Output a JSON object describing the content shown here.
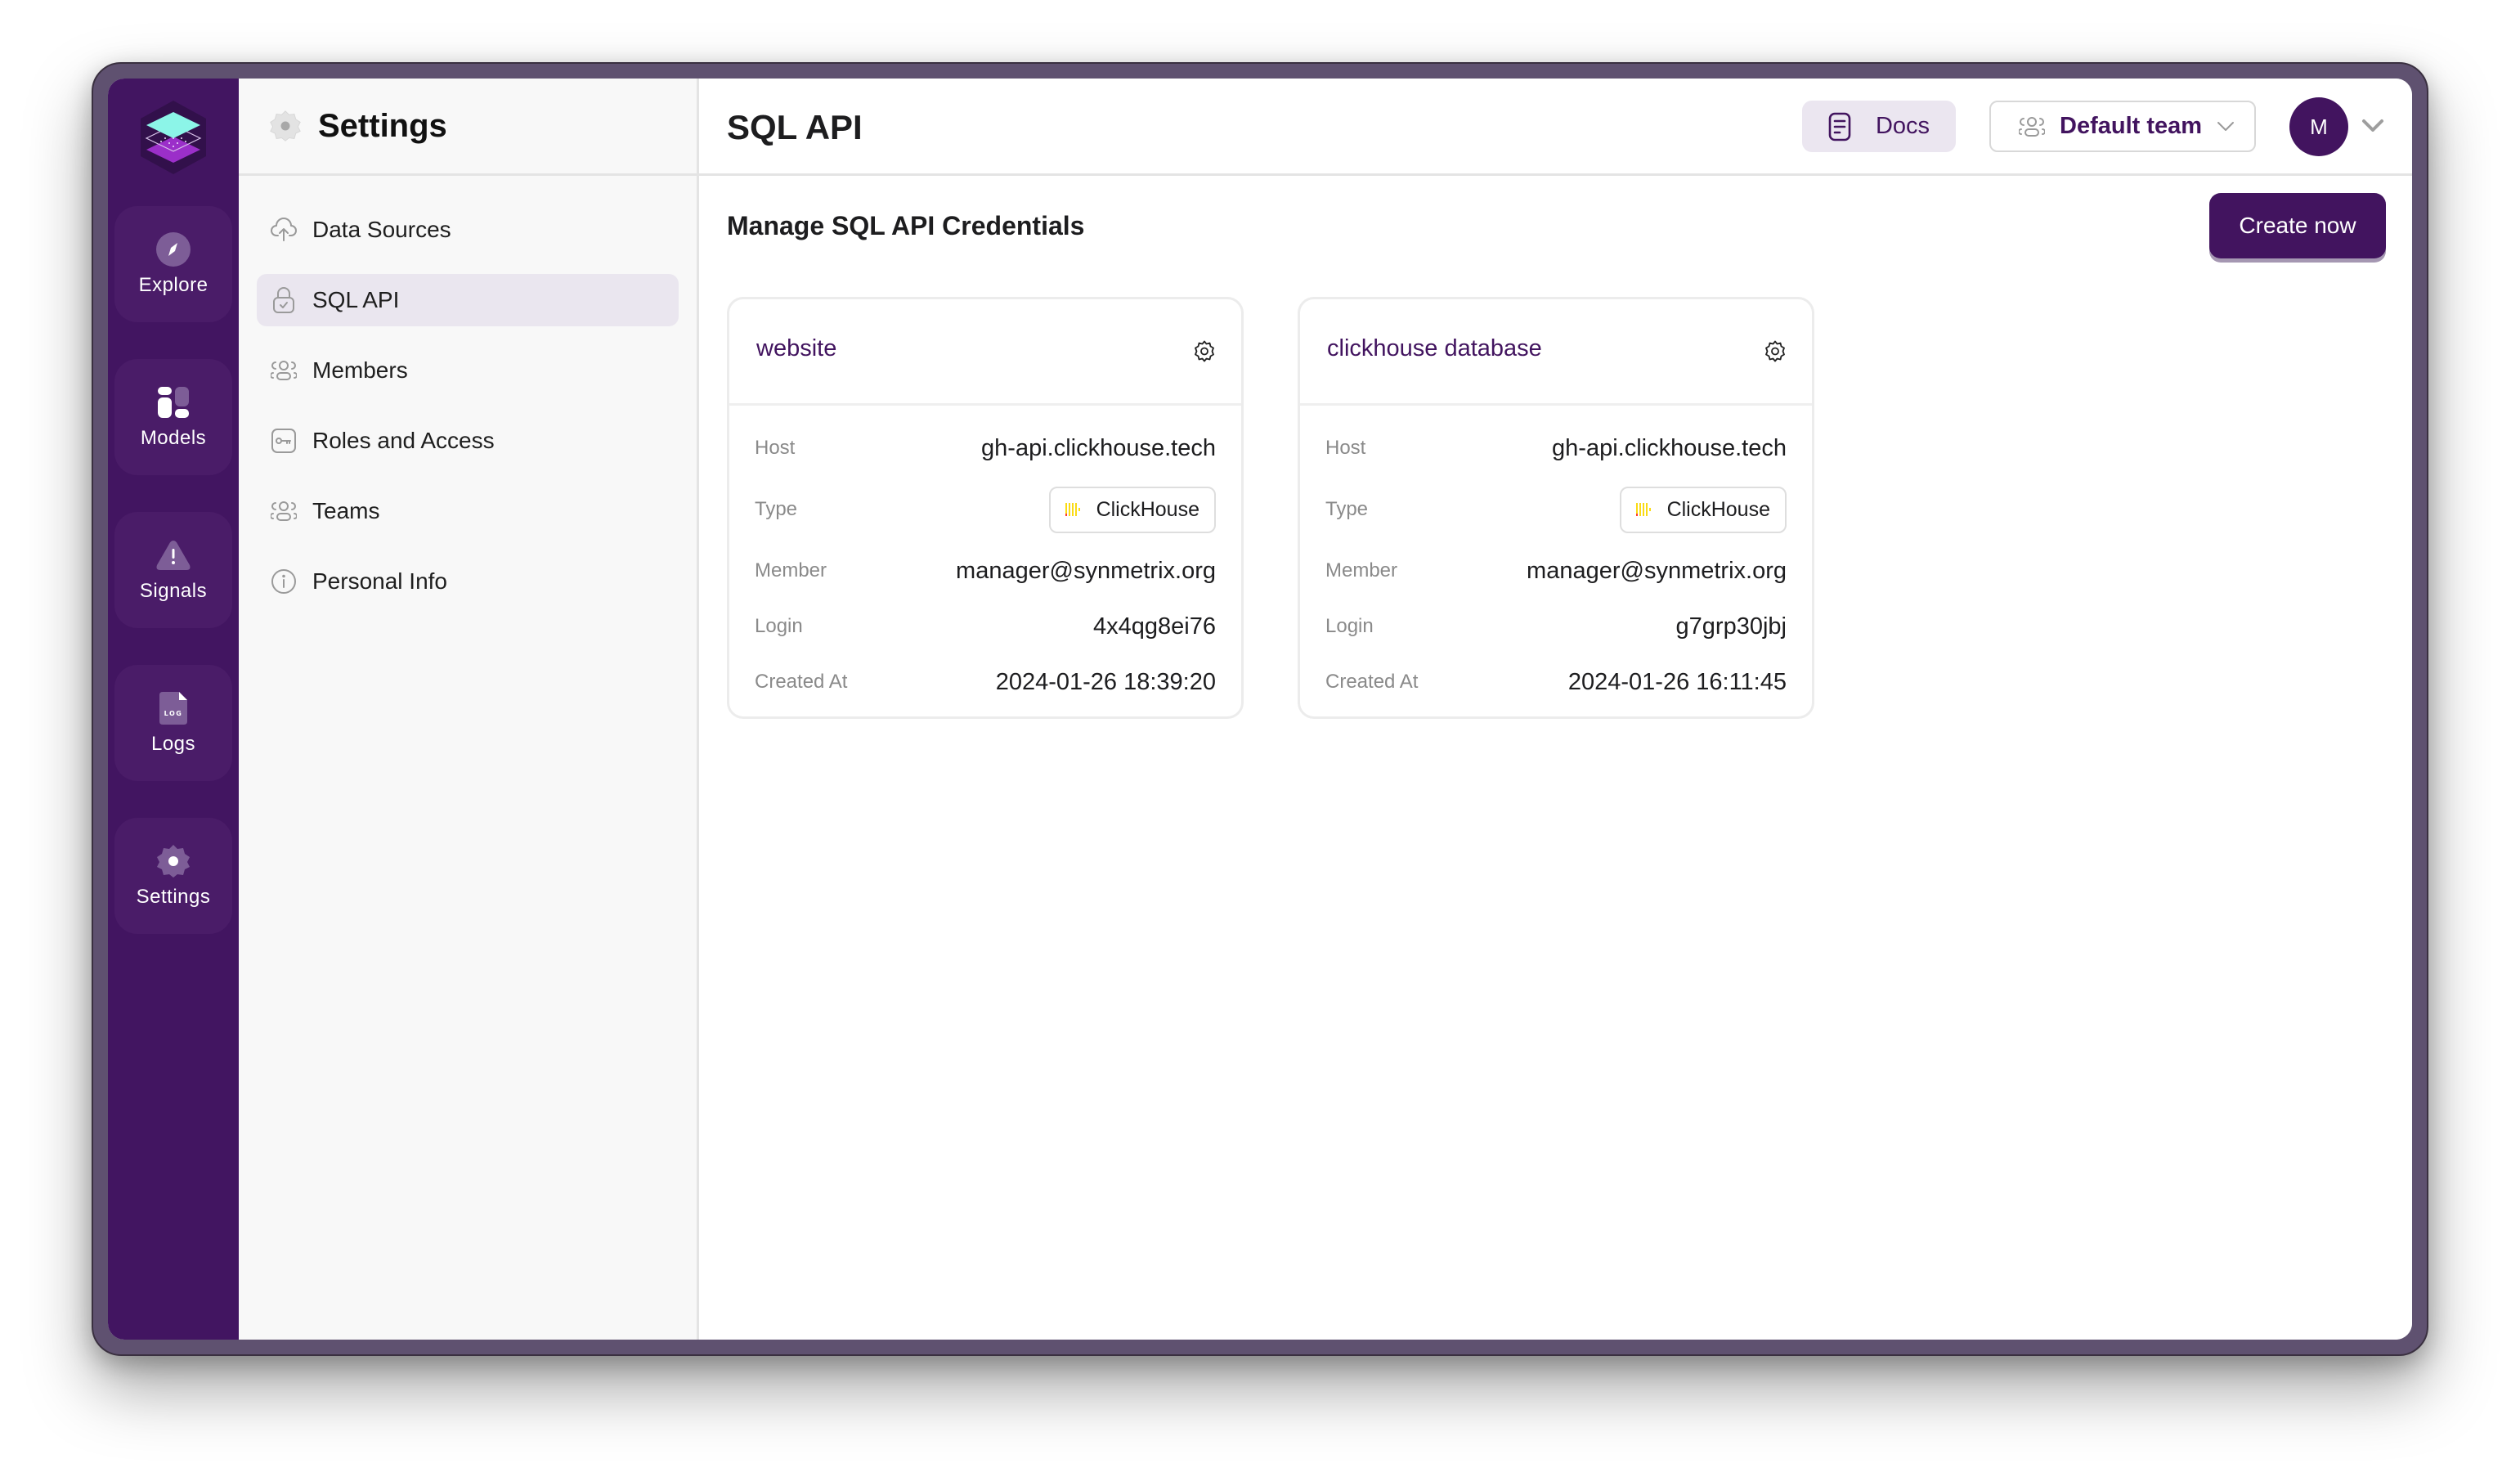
{
  "rail": {
    "items": [
      {
        "label": "Explore",
        "icon": "compass-icon"
      },
      {
        "label": "Models",
        "icon": "models-icon"
      },
      {
        "label": "Signals",
        "icon": "warning-icon"
      },
      {
        "label": "Logs",
        "icon": "log-file-icon"
      },
      {
        "label": "Settings",
        "icon": "gear-icon"
      }
    ]
  },
  "settings_panel": {
    "title": "Settings",
    "items": [
      {
        "label": "Data Sources",
        "icon": "cloud-upload-icon",
        "active": false
      },
      {
        "label": "SQL API",
        "icon": "lock-icon",
        "active": true
      },
      {
        "label": "Members",
        "icon": "users-icon",
        "active": false
      },
      {
        "label": "Roles and Access",
        "icon": "key-icon",
        "active": false
      },
      {
        "label": "Teams",
        "icon": "users-icon",
        "active": false
      },
      {
        "label": "Personal Info",
        "icon": "info-icon",
        "active": false
      }
    ]
  },
  "header": {
    "title": "SQL API",
    "docs_label": "Docs",
    "team_select_value": "Default team",
    "avatar_initial": "M"
  },
  "content": {
    "section_title": "Manage SQL API Credentials",
    "create_label": "Create now",
    "field_labels": {
      "host": "Host",
      "type": "Type",
      "member": "Member",
      "login": "Login",
      "created_at": "Created At"
    },
    "credentials": [
      {
        "name": "website",
        "host": "gh-api.clickhouse.tech",
        "type": "ClickHouse",
        "member": "manager@synmetrix.org",
        "login": "4x4qg8ei76",
        "created_at": "2024-01-26 18:39:20"
      },
      {
        "name": "clickhouse database",
        "host": "gh-api.clickhouse.tech",
        "type": "ClickHouse",
        "member": "manager@synmetrix.org",
        "login": "g7grp30jbj",
        "created_at": "2024-01-26 16:11:45"
      }
    ]
  },
  "colors": {
    "brand": "#42145f",
    "rail_bg": "#421561",
    "active_nav_bg": "#eae6ef",
    "docs_bg": "#ebe6f0"
  }
}
